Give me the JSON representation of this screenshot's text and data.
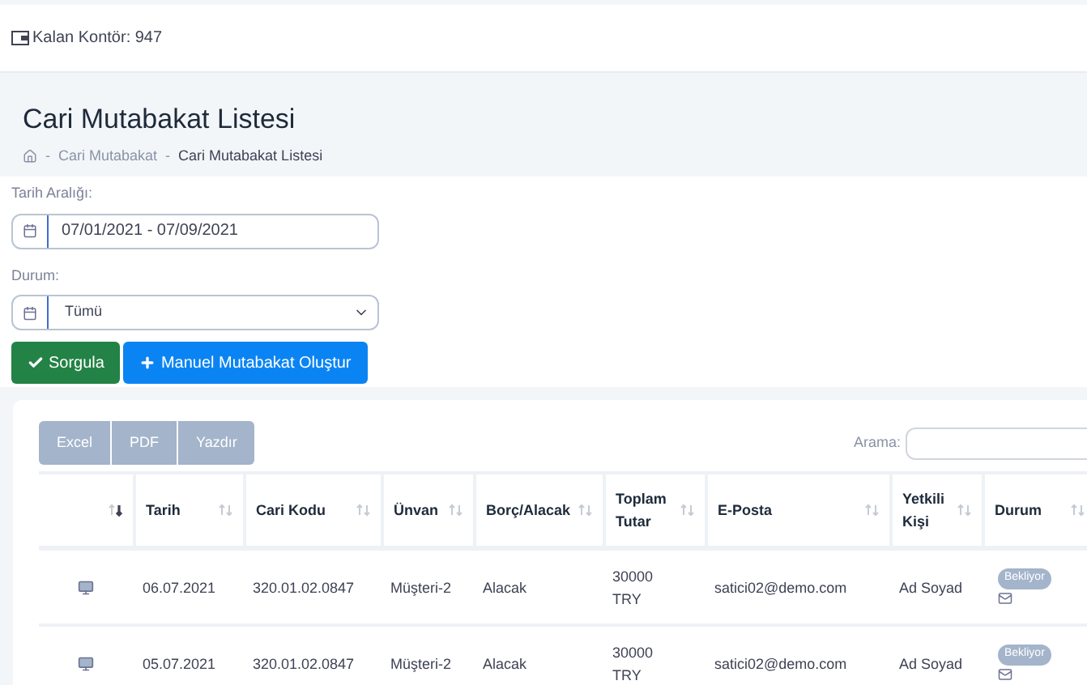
{
  "topbar": {
    "credit": "Kalan Kontör: 947"
  },
  "page": {
    "title": "Cari Mutabakat Listesi",
    "breadcrumb_separator": "-",
    "breadcrumb": [
      "Cari Mutabakat",
      "Cari Mutabakat Listesi"
    ]
  },
  "filters": {
    "date_label": "Tarih Aralığı:",
    "date_value": "07/01/2021 - 07/09/2021",
    "status_label": "Durum:",
    "status_value": "Tümü"
  },
  "actions": [
    {
      "label": "Sorgula",
      "kind": "query"
    },
    {
      "label": "Manuel Mutabakat Oluştur",
      "kind": "create"
    }
  ],
  "export_buttons": [
    "Excel",
    "PDF",
    "Yazdır"
  ],
  "search": {
    "label": "Arama:"
  },
  "table": {
    "columns": [
      {
        "sorted": true
      },
      {
        "label": "Tarih",
        "sorted": false
      },
      {
        "label": "Cari Kodu",
        "sorted": false
      },
      {
        "label": "Ünvan",
        "sorted": false
      },
      {
        "label": "Borç/Alacak",
        "sorted": false
      },
      {
        "label": "Toplam Tutar",
        "sorted": false
      },
      {
        "label": "E-Posta",
        "sorted": false
      },
      {
        "label": "Yetkili Kişi",
        "sorted": false
      },
      {
        "label": "Durum",
        "sorted": false
      }
    ],
    "rows": [
      {
        "date": "06.07.2021",
        "code": "320.01.02.0847",
        "title": "Müşteri-2",
        "type": "Alacak",
        "total": "30000 TRY",
        "email": "satici02@demo.com",
        "contact": "Ad Soyad",
        "status": "Bekliyor"
      },
      {
        "date": "05.07.2021",
        "code": "320.01.02.0847",
        "title": "Müşteri-2",
        "type": "Alacak",
        "total": "30000 TRY",
        "email": "satici02@demo.com",
        "contact": "Ad Soyad",
        "status": "Bekliyor"
      }
    ]
  }
}
